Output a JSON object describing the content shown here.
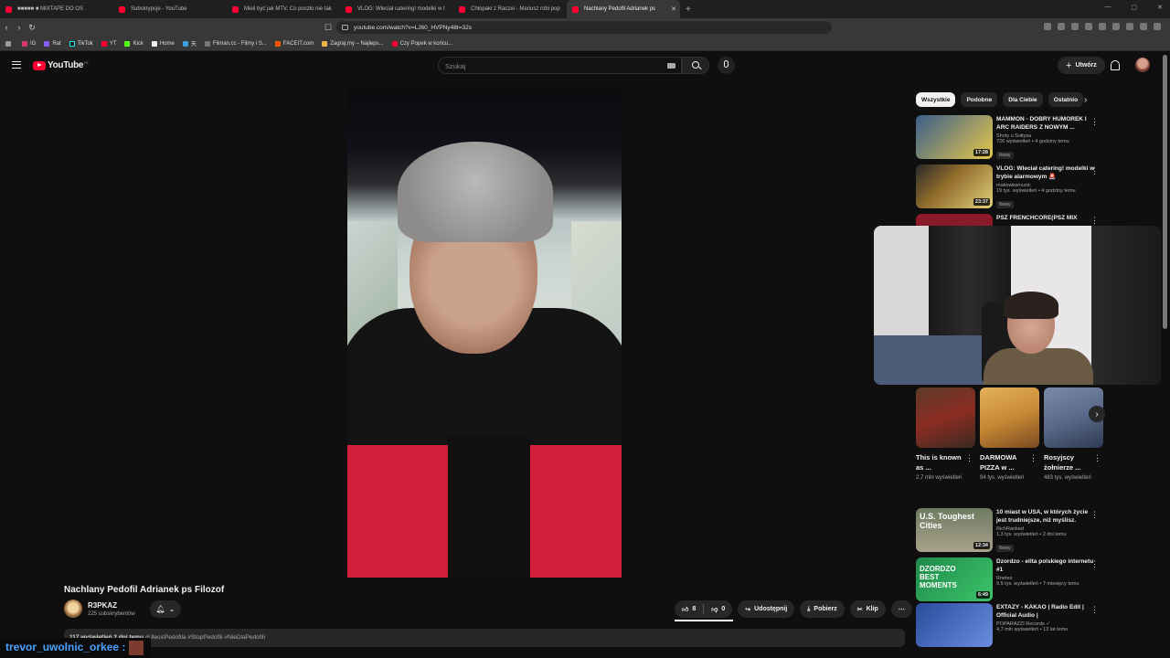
{
  "browser": {
    "tabs": [
      {
        "label": "■■■■■ ■ MIXTAPE DO OS"
      },
      {
        "label": "Subskrypcje - YouTube"
      },
      {
        "label": "Mieli być jak MTV. Co poszło nie tak"
      },
      {
        "label": "VLOG: Wleciał catering! modelki w t"
      },
      {
        "label": "Chłopaki z Raczei - Mariusz robi pop"
      },
      {
        "label": "Nachlany Pedofil Adrianek ps"
      }
    ],
    "url": "youtube.com/watch?v=LJ60_HVPNy48t=32s",
    "bookmarks": [
      "IG",
      "Rat",
      "TikTok",
      "YT",
      "Kick",
      "Home",
      "天",
      "Filman.cc - Filmy i S...",
      "FACEIT.com",
      "Zagraj.my – Najleps...",
      "Czy Popek w końcu..."
    ]
  },
  "header": {
    "logo": "YouTube",
    "country": "PL",
    "search_placeholder": "Szukaj",
    "create_label": "Utwórz"
  },
  "video": {
    "title": "Nachlany Pedofil Adrianek ps Filozof",
    "channel": "R3PKAZ",
    "subscribers": "225 subskrybentów",
    "likes": "8",
    "dislikes": "0",
    "share": "Udostępnij",
    "download": "Pobierz",
    "clip": "Klip",
    "desc_stats": "117 wyświetleń  2 dni temu",
    "desc_tags": "#UlecicPedofila #StopPedofili #NieDlaPedofili"
  },
  "chat": {
    "user": "trevor_uwolnic_orkee :"
  },
  "chips": [
    "Wszystkie",
    "Podobne",
    "Dla Ciebie",
    "Ostatnio"
  ],
  "recs_top": [
    {
      "title": "MAMMON - DOBRY HUMOREK I ARC RAIDERS Z NOWYM ...",
      "channel": "Shoty u Sołtysa",
      "views": "726 wyświetleń • 4 godziny temu",
      "badge": "Nowy",
      "dur": "17:28",
      "color": "#3a5d8a"
    },
    {
      "title": "VLOG: Wleciał catering! modelki w trybie alarmowym 🚨",
      "channel": "makowkamusic",
      "views": "19 tys. wyświetleń • 4 godziny temu",
      "badge": "Nowy",
      "dur": "23:37",
      "color": "#8f6a2b"
    },
    {
      "title": "PSZ FRENCHCORE(PSZ MIX",
      "channel": "",
      "views": "",
      "badge": "",
      "dur": "",
      "color": "#8a1a2a"
    }
  ],
  "shorts": [
    {
      "title": "This is known as ...",
      "views": "2,7 mln wyświetleń",
      "color": "#6b2a22"
    },
    {
      "title": "DARMOWA PIZZA w ...",
      "views": "94 tys. wyświetleń",
      "color": "#c88a34"
    },
    {
      "title": "Rosyjscy żołnierze ...",
      "views": "483 tys. wyświetleń",
      "color": "#5a6a8a"
    }
  ],
  "recs_bottom": [
    {
      "title": "10 miast w USA, w których życie jest trudniejsze, niż myślisz.",
      "channel": "RichRanked",
      "views": "1,3 tys. wyświetleń • 2 dni temu",
      "badge": "Nowy",
      "dur": "12:34",
      "thumb_text": "U.S. Toughest Cities",
      "color": "#6f7a62"
    },
    {
      "title": "Dzordzo - elita polskiego internetu #1",
      "channel": "Rnetes",
      "views": "9,5 tys. wyświetleń • 7 miesięcy temu",
      "badge": "",
      "dur": "6:49",
      "thumb_text": "DZORDZO BEST MOMENTS",
      "color": "#1f8a4a"
    },
    {
      "title": "EXTAZY - KAKAO | Radio Edit | Official Audio |",
      "channel": "POPARAZZI Records ✓",
      "views": "4,7 mln wyświetleń • 13 lat temu",
      "badge": "",
      "dur": "",
      "thumb_text": "",
      "color": "#2a4a9a"
    }
  ]
}
